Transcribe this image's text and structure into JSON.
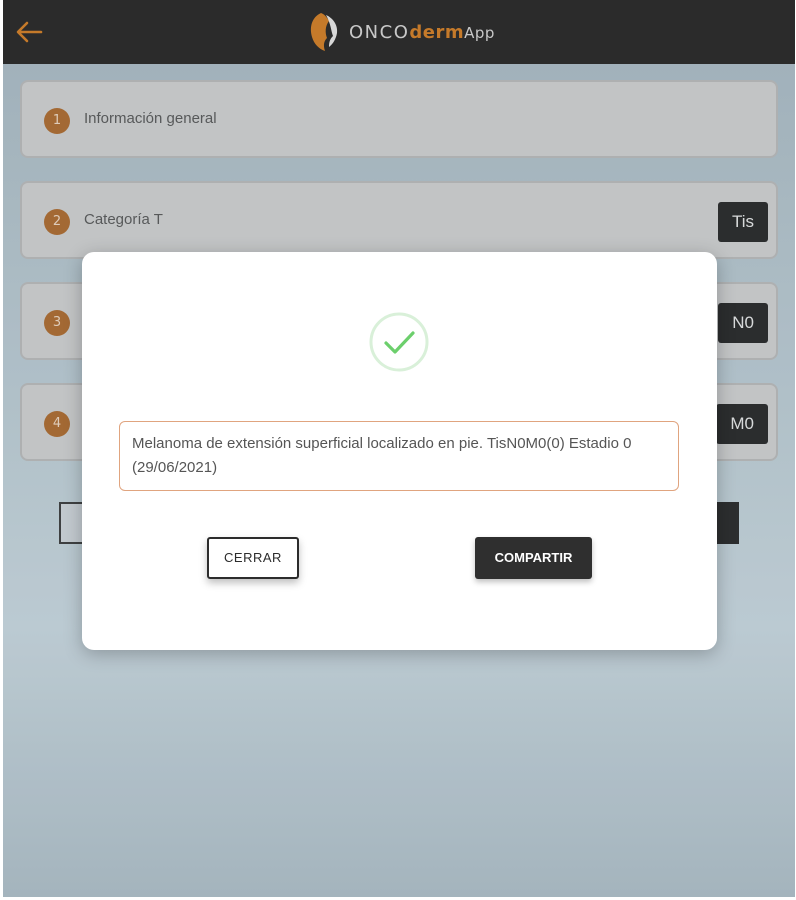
{
  "header": {
    "logo": {
      "onco": "ONCO",
      "derm": "derm",
      "app": "App"
    },
    "back_icon": "arrow-left-icon",
    "accent_color": "#c57a2a"
  },
  "steps": [
    {
      "number": "1",
      "label": "Información general",
      "value": ""
    },
    {
      "number": "2",
      "label": "Categoría T",
      "value": "Tis"
    },
    {
      "number": "3",
      "label": "",
      "value": "N0"
    },
    {
      "number": "4",
      "label": "",
      "value": "M0"
    }
  ],
  "modal": {
    "icon": "check-circle-icon",
    "message": "Melanoma de extensión superficial localizado en pie. TisN0M0(0) Estadio 0 (29/06/2021)",
    "close_label": "CERRAR",
    "share_label": "COMPARTIR",
    "success_color": "#6ccf6c"
  }
}
